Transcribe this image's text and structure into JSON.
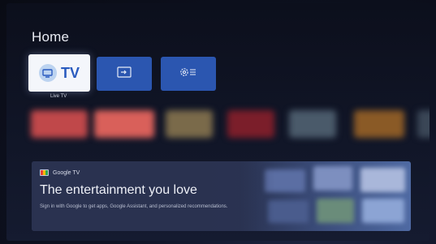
{
  "header": {
    "title": "Home"
  },
  "tiles": {
    "tv": {
      "label": "TV",
      "caption": "Live TV",
      "icon": "tv-icon"
    },
    "input": {
      "icon": "input-source-icon"
    },
    "settings": {
      "icon": "settings-icon"
    }
  },
  "app_row": [
    {
      "color": "#c0484a"
    },
    {
      "color": "#d9605a"
    },
    {
      "color": "#7a6a4a"
    },
    {
      "color": "#7b1e2a"
    },
    {
      "color": "#4a5a6a"
    },
    {
      "color": "#8a5a26"
    },
    {
      "color": "#3a4656"
    }
  ],
  "banner": {
    "brand": "Google TV",
    "headline": "The entertainment you love",
    "subtext": "Sign in with Google to get apps, Google Assistant, and personalized recommendations."
  },
  "colors": {
    "accent": "#2b56b0",
    "tv_text": "#2a5bbf"
  }
}
